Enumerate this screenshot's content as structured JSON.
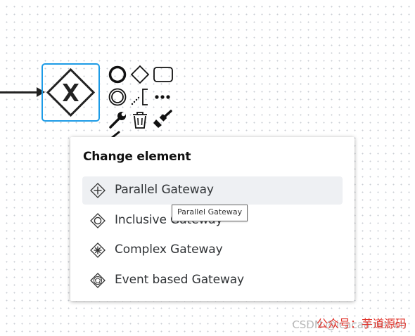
{
  "popup": {
    "title": "Change element",
    "items": [
      {
        "label": "Parallel Gateway",
        "icon": "parallel-gateway-icon",
        "active": true
      },
      {
        "label": "Inclusive Gateway",
        "icon": "inclusive-gateway-icon",
        "active": false
      },
      {
        "label": "Complex Gateway",
        "icon": "complex-gateway-icon",
        "active": false
      },
      {
        "label": "Event based Gateway",
        "icon": "event-based-gateway-icon",
        "active": false
      }
    ]
  },
  "tooltip": {
    "text": "Parallel Gateway"
  },
  "watermark": {
    "gray_text": "CSDN @icacaa.net.cn",
    "red_text": "公众号：芋道源码"
  },
  "colors": {
    "selection": "#1c9be6",
    "popup_hover": "#eef0f3",
    "watermark_red": "#e0322a"
  }
}
